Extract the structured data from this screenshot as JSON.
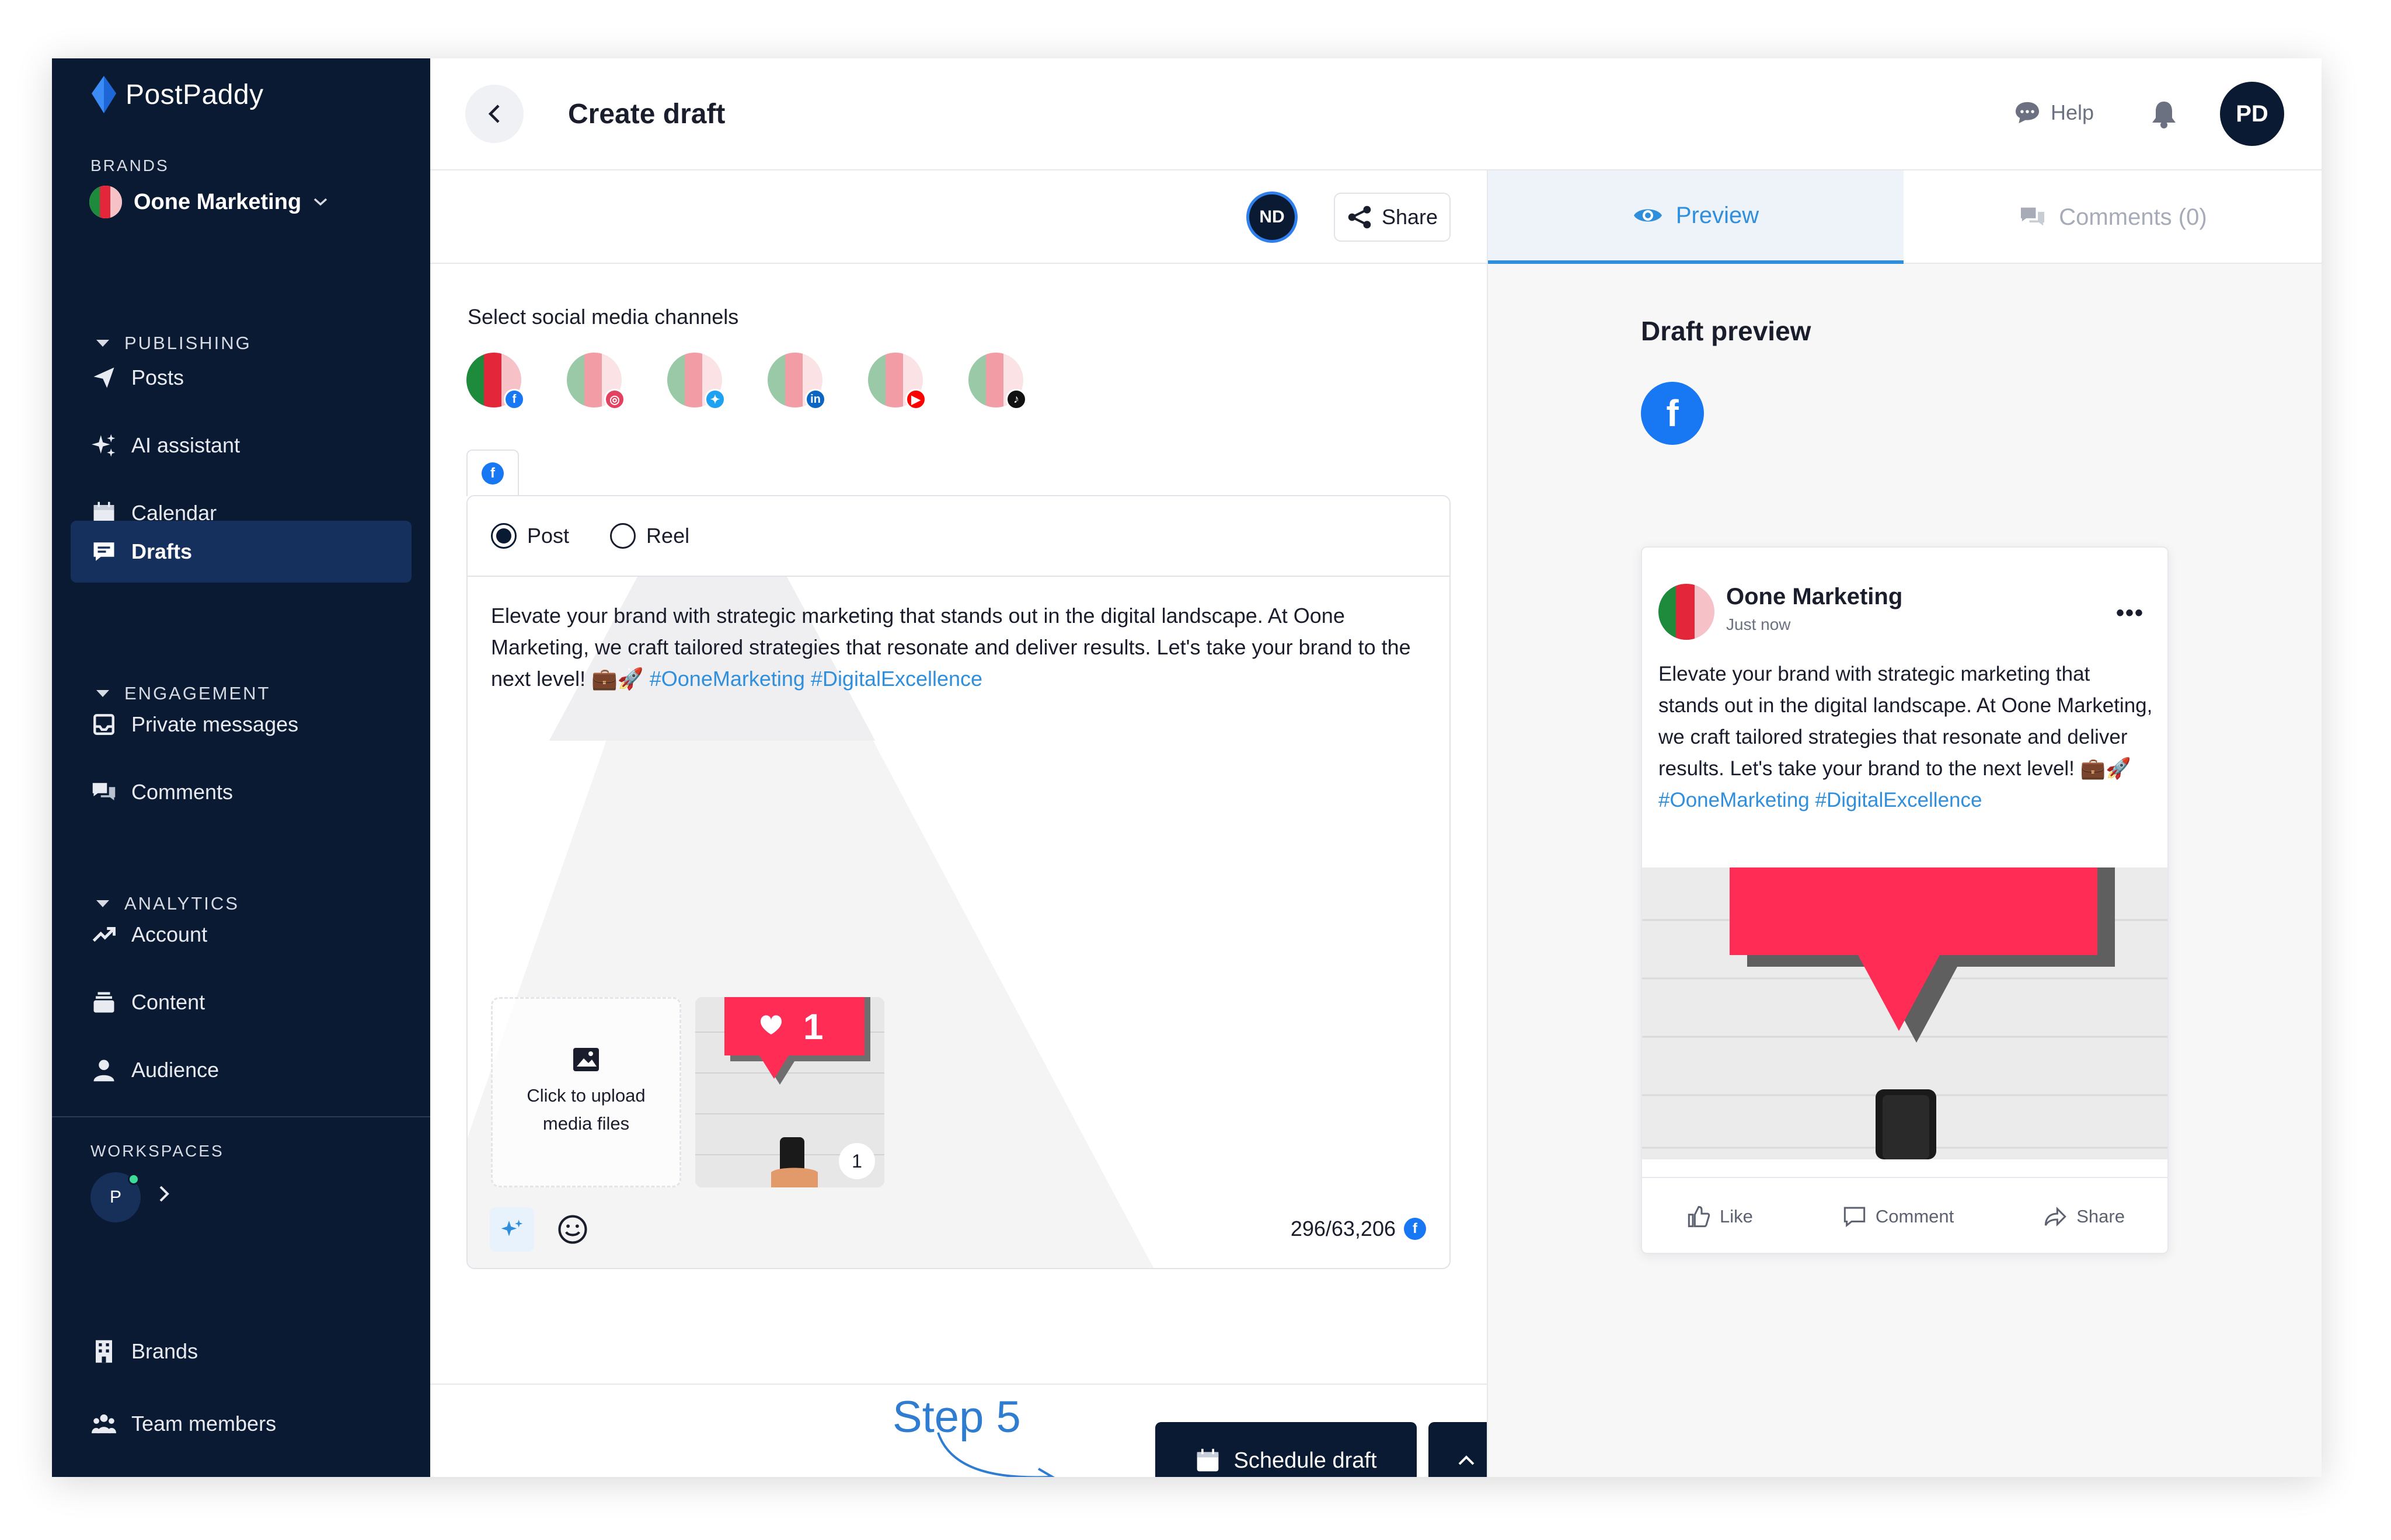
{
  "app": {
    "name": "PostPaddy",
    "brands_label": "BRANDS",
    "brand_name": "Oone Marketing",
    "workspaces_label": "WORKSPACES",
    "workspace_initial": "P"
  },
  "sidebar": {
    "groups": [
      {
        "title": "PUBLISHING",
        "items": [
          {
            "label": "Posts",
            "icon": "paper-plane-icon"
          },
          {
            "label": "AI assistant",
            "icon": "sparkles-icon"
          },
          {
            "label": "Calendar",
            "icon": "calendar-icon"
          },
          {
            "label": "Drafts",
            "icon": "drafts-icon",
            "active": true
          }
        ]
      },
      {
        "title": "ENGAGEMENT",
        "items": [
          {
            "label": "Private messages",
            "icon": "inbox-icon"
          },
          {
            "label": "Comments",
            "icon": "comments-icon"
          }
        ]
      },
      {
        "title": "ANALYTICS",
        "items": [
          {
            "label": "Account",
            "icon": "trend-icon"
          },
          {
            "label": "Content",
            "icon": "stack-icon"
          },
          {
            "label": "Audience",
            "icon": "person-icon"
          }
        ]
      }
    ],
    "bottom": [
      {
        "label": "Brands",
        "icon": "building-icon"
      },
      {
        "label": "Team members",
        "icon": "team-icon"
      }
    ]
  },
  "header": {
    "title": "Create draft",
    "help_label": "Help",
    "user_initials": "PD"
  },
  "editor": {
    "collaborator_initials": "ND",
    "share_label": "Share",
    "channels_label": "Select social media channels",
    "channels": [
      {
        "network": "facebook",
        "selected": true,
        "badge_color": "#1877f2",
        "badge_glyph": "f"
      },
      {
        "network": "instagram",
        "selected": false,
        "badge_color": "#e4405f",
        "badge_glyph": "◎"
      },
      {
        "network": "twitter",
        "selected": false,
        "badge_color": "#1da1f2",
        "badge_glyph": "✦"
      },
      {
        "network": "linkedin",
        "selected": false,
        "badge_color": "#0a66c2",
        "badge_glyph": "in"
      },
      {
        "network": "youtube",
        "selected": false,
        "badge_color": "#ff0000",
        "badge_glyph": "▶"
      },
      {
        "network": "tiktok",
        "selected": false,
        "badge_color": "#111111",
        "badge_glyph": "♪"
      }
    ],
    "post_types": [
      "Post",
      "Reel"
    ],
    "selected_type": "Post",
    "body_text": "Elevate your brand with strategic marketing that stands out in the digital landscape. At Oone Marketing, we craft tailored strategies that resonate and deliver results. Let's take your brand to the next level! 💼🚀",
    "hashtags": "#OoneMarketing #DigitalExcellence",
    "upload_label": "Click to upload media files",
    "media_count": "1",
    "char_count": "296/63,206",
    "step_label": "Step 5",
    "schedule_label": "Schedule draft"
  },
  "preview": {
    "tab_preview": "Preview",
    "tab_comments": "Comments (0)",
    "title": "Draft preview",
    "page_name": "Oone Marketing",
    "time": "Just now",
    "text": "Elevate your brand with strategic marketing that stands out in the digital landscape. At Oone Marketing, we craft tailored strategies that resonate and deliver results. Let's take your brand to the next level! 💼🚀",
    "hashtag_1": "#OoneMarketing",
    "hashtag_2": "#DigitalExcellence",
    "actions": [
      "Like",
      "Comment",
      "Share"
    ]
  },
  "colors": {
    "sidebar_bg": "#0b1a33",
    "accent": "#2f8fdc",
    "facebook": "#1877f2",
    "step_blue": "#2f7dd1"
  }
}
